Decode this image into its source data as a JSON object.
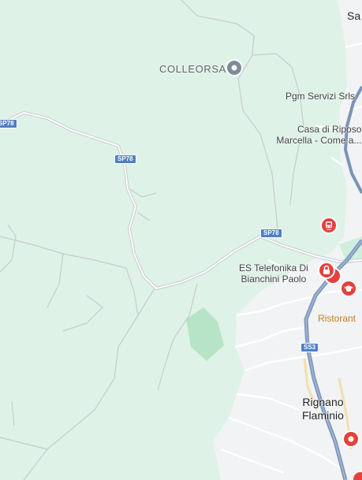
{
  "map": {
    "places": {
      "colleorsa": "COLLEORSA",
      "sa_partial": "Sa",
      "rignano_line1": "Rignano",
      "rignano_line2": "Flaminio"
    },
    "pois": {
      "pgm": "Pgm Servizi Srls",
      "casa_line1": "Casa di Riposo",
      "casa_line2": "Marcella -  Come a...",
      "es_line1": "ES Telefonika Di",
      "es_line2": "Bianchini Paolo",
      "ristorante": "Ristorant"
    },
    "roads": {
      "sp78_a": "SP78",
      "sp78_b": "SP78",
      "sp78_c": "SP78",
      "ss3": "SS3"
    },
    "colors": {
      "green_area": "#dff2e7",
      "town_area": "#f1f3f4",
      "park": "#b7e4c7",
      "highway": "#7a93b8",
      "road": "#ffffff",
      "minor_road": "#c6cbd0",
      "pin_red": "#e5413c",
      "pin_gray": "#7e8c99",
      "restaurant_text": "#c5761c"
    },
    "icons": [
      "place-pin-icon",
      "train-station-icon",
      "lock-icon",
      "school-icon",
      "location-pin-icon"
    ]
  }
}
